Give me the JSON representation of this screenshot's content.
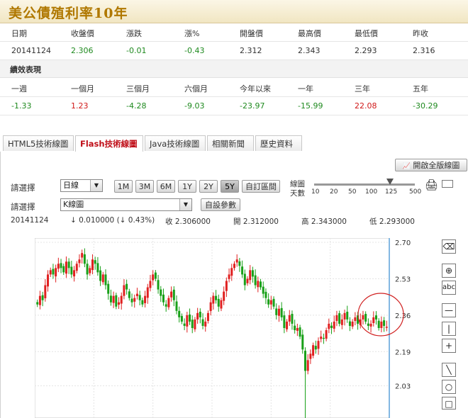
{
  "page_title": "美公債殖利率10年",
  "quote": {
    "headers": [
      "日期",
      "收盤價",
      "漲跌",
      "漲%",
      "開盤價",
      "最高價",
      "最低價",
      "昨收"
    ],
    "values": [
      "20141124",
      "2.306",
      "-0.01",
      "-0.43",
      "2.312",
      "2.343",
      "2.293",
      "2.316"
    ]
  },
  "performance": {
    "title": "績效表現",
    "headers": [
      "一週",
      "一個月",
      "三個月",
      "六個月",
      "今年以來",
      "一年",
      "三年",
      "五年"
    ],
    "values": [
      "-1.33",
      "1.23",
      "-4.28",
      "-9.03",
      "-23.97",
      "-15.99",
      "22.08",
      "-30.29"
    ]
  },
  "tabs": [
    "HTML5技術線圖",
    "Flash技術線圖",
    "Java技術線圖",
    "相關新聞",
    "歷史資料"
  ],
  "toolbar": {
    "fullscreen_label": "開啟全版線圖",
    "select_label": "請選擇",
    "period_value": "日線",
    "range_buttons": [
      "1M",
      "3M",
      "6M",
      "1Y",
      "2Y",
      "5Y"
    ],
    "custom_range_label": "自訂區間",
    "slider_label_1": "線圖",
    "slider_label_2": "天數",
    "slider_ticks": [
      "10",
      "20",
      "50",
      "100",
      "125",
      "500"
    ],
    "chart_type_value": "K線圖",
    "custom_params_label": "自設參數"
  },
  "info_line": {
    "date": "20141124",
    "change": "↓ 0.010000 (↓ 0.43%)",
    "close": "收 2.306000",
    "open": "開 2.312000",
    "high": "高 2.343000",
    "low": "低 2.293000"
  },
  "chart_data": {
    "type": "candlestick",
    "y_ticks": [
      "2.70",
      "2.53",
      "2.36",
      "2.19",
      "2.03"
    ],
    "ylim": [
      1.88,
      2.72
    ],
    "grid": true,
    "up_color": "#e02020",
    "down_color": "#18a018",
    "closes": [
      2.41,
      2.45,
      2.43,
      2.5,
      2.55,
      2.57,
      2.55,
      2.58,
      2.6,
      2.58,
      2.56,
      2.61,
      2.58,
      2.55,
      2.57,
      2.6,
      2.62,
      2.65,
      2.6,
      2.55,
      2.58,
      2.62,
      2.6,
      2.56,
      2.52,
      2.55,
      2.5,
      2.46,
      2.42,
      2.45,
      2.4,
      2.42,
      2.45,
      2.5,
      2.48,
      2.44,
      2.42,
      2.44,
      2.46,
      2.43,
      2.41,
      2.45,
      2.49,
      2.52,
      2.55,
      2.53,
      2.48,
      2.45,
      2.42,
      2.4,
      2.44,
      2.47,
      2.43,
      2.38,
      2.35,
      2.33,
      2.31,
      2.36,
      2.33,
      2.3,
      2.34,
      2.37,
      2.35,
      2.31,
      2.33,
      2.37,
      2.42,
      2.45,
      2.43,
      2.4,
      2.43,
      2.47,
      2.52,
      2.55,
      2.58,
      2.6,
      2.62,
      2.59,
      2.55,
      2.5,
      2.53,
      2.57,
      2.54,
      2.5,
      2.52,
      2.49,
      2.46,
      2.44,
      2.41,
      2.43,
      2.4,
      2.36,
      2.39,
      2.35,
      2.3,
      2.33,
      2.36,
      2.32,
      2.29,
      2.3,
      2.26,
      2.2,
      2.1,
      2.15,
      2.18,
      2.22,
      2.2,
      2.24,
      2.26,
      2.25,
      2.29,
      2.32,
      2.3,
      2.33,
      2.36,
      2.32,
      2.34,
      2.37,
      2.34,
      2.31,
      2.33,
      2.35,
      2.32,
      2.34,
      2.36,
      2.33,
      2.31,
      2.32,
      2.35,
      2.34,
      2.3,
      2.33,
      2.31,
      2.306
    ]
  }
}
